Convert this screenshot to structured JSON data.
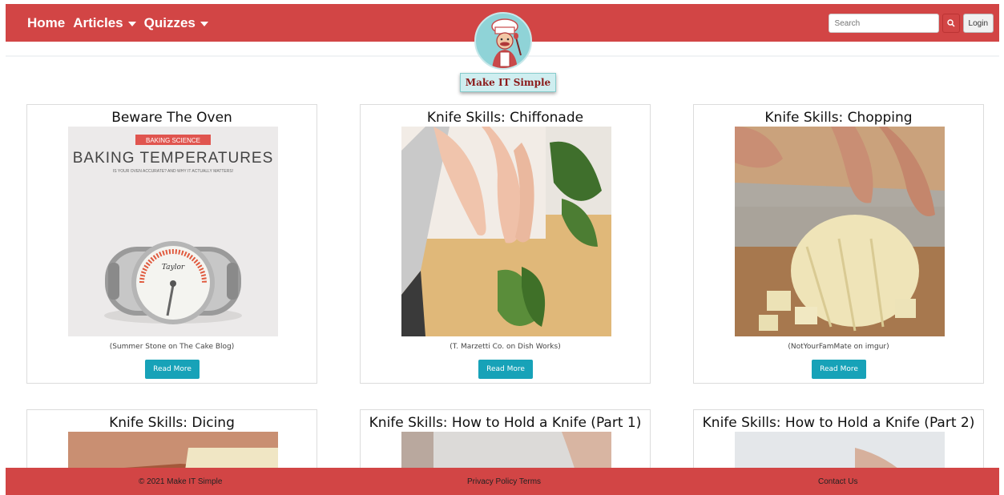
{
  "nav": {
    "items": [
      {
        "label": "Home",
        "dropdown": false
      },
      {
        "label": "Articles",
        "dropdown": true
      },
      {
        "label": "Quizzes",
        "dropdown": true
      }
    ],
    "search_placeholder": "Search",
    "search_icon": "search-icon",
    "login_label": "Login",
    "color": "#d24545"
  },
  "logo": {
    "text": "Make IT Simple",
    "icon": "chef-icon"
  },
  "cards": [
    {
      "title": "Beware The Oven",
      "credit": "(Summer Stone on The Cake Blog)",
      "button": "Read More",
      "image_text": {
        "tag": "BAKING SCIENCE",
        "headline": "BAKING TEMPERATURES",
        "sub": "IS YOUR OVEN ACCURATE? AND WHY IT ACTUALLY MATTERS!"
      }
    },
    {
      "title": "Knife Skills: Chiffonade",
      "credit": "(T. Marzetti Co. on Dish Works)",
      "button": "Read More"
    },
    {
      "title": "Knife Skills: Chopping",
      "credit": "(NotYourFamMate on imgur)",
      "button": "Read More"
    },
    {
      "title": "Knife Skills: Dicing"
    },
    {
      "title": "Knife Skills: How to Hold a Knife (Part 1)"
    },
    {
      "title": "Knife Skills: How to Hold a Knife (Part 2)"
    }
  ],
  "footer": {
    "copyright": "© 2021 Make IT Simple",
    "links": "Privacy Policy Terms",
    "contact": "Contact Us"
  },
  "colors": {
    "brand": "#d24545",
    "button": "#17a2b8"
  }
}
